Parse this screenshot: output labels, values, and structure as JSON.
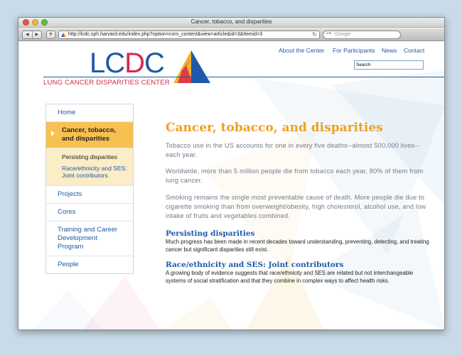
{
  "browser": {
    "window_title": "Cancer, tobacco, and disparities",
    "url": "http://lcdc.sph.harvard.edu/index.php?option=com_content&view=article&id=3&Itemid=3",
    "search_placeholder": "Google",
    "back_glyph": "◀",
    "forward_glyph": "▶",
    "plus_glyph": "+",
    "reload_glyph": "↻",
    "search_glyph": "⌕▾"
  },
  "site": {
    "logo_lc": "LC",
    "logo_d": "D",
    "logo_c": "C",
    "logo_subtitle": "LUNG CANCER DISPARITIES CENTER",
    "nav": [
      "About the Center",
      "For Participants",
      "News",
      "Contact"
    ],
    "search_value": "Search"
  },
  "sidebar": {
    "items": [
      "Home",
      "Cancer, tobacco, and disparities",
      "Projects",
      "Cores",
      "Training and Career Development Program",
      "People"
    ],
    "subitems": [
      "Persisting disparities",
      "Race/ethnicity and SES: Joint contributors"
    ]
  },
  "content": {
    "title": "Cancer, tobacco, and disparities",
    "paragraphs": [
      "Tobacco use in the US accounts for one in every five deaths--almost 500,000 lives--each year.",
      "Worldwide, more than 5 million people die from tobacco each year, 80% of them from lung cancer.",
      "Smoking remains the single most preventable cause of death. More people die due to cigarette smoking than from overweight/obesity, high cholesterol, alcohol use, and low intake of fruits and vegetables combined."
    ],
    "sections": [
      {
        "title": "Persisting disparities",
        "body": "Much progress has been made in recent decades toward understanding, preventing, detecting, and treating cancer but significant disparities still exist."
      },
      {
        "title": "Race/ethnicity and SES: Joint contributors",
        "body": "A growing body of evidence suggests that race/ethnicity and SES are related but not interchangeable systems of social stratification and that they combine in complex ways to affect health risks."
      }
    ]
  },
  "colors": {
    "brand_blue": "#1f5aa8",
    "brand_red": "#d9284d",
    "accent_orange": "#f0a020",
    "active_bg": "#f7c050",
    "sub_bg": "#fbedc6"
  }
}
